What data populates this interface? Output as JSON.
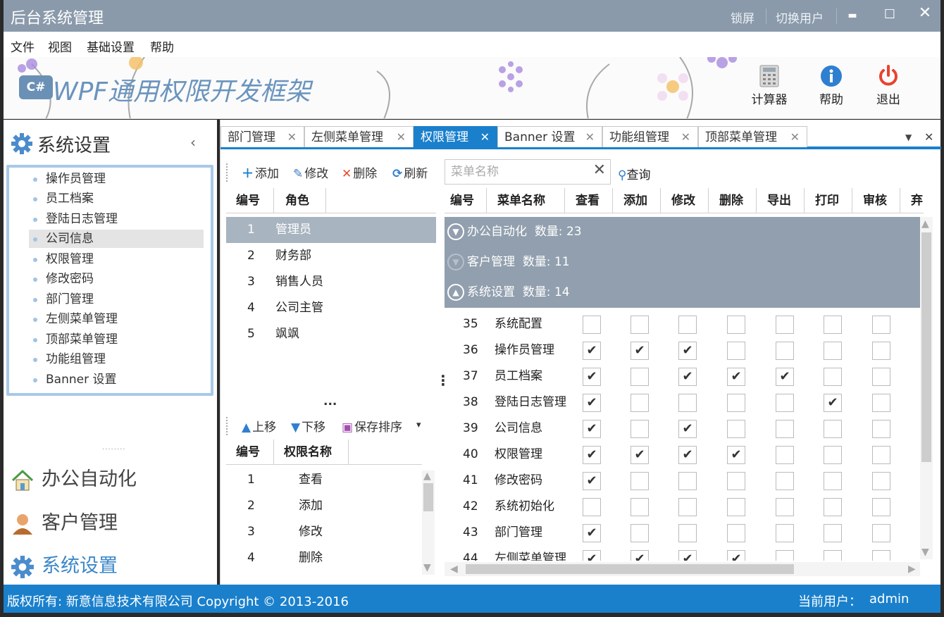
{
  "window": {
    "title": "后台系统管理",
    "lock_label": "锁屏",
    "switch_user_label": "切换用户",
    "minimize": "▬",
    "maximize": "☐",
    "close": "✕"
  },
  "menu": [
    "文件",
    "视图",
    "基础设置",
    "帮助"
  ],
  "banner": {
    "logo_text": "C#",
    "app_title": "WPF通用权限开发框架",
    "tools": [
      {
        "label": "计算器",
        "icon": "calculator-icon"
      },
      {
        "label": "帮助",
        "icon": "info-icon"
      },
      {
        "label": "退出",
        "icon": "power-icon"
      }
    ]
  },
  "sidebar": {
    "header": "系统设置",
    "collapse_glyph": "‹",
    "items": [
      "操作员管理",
      "员工档案",
      "登陆日志管理",
      "公司信息",
      "权限管理",
      "修改密码",
      "部门管理",
      "左侧菜单管理",
      "顶部菜单管理",
      "功能组管理",
      "Banner 设置"
    ],
    "selected_index": 3,
    "splitter": "........",
    "nav": [
      "办公自动化",
      "客户管理",
      "系统设置"
    ],
    "active_nav": 2
  },
  "tabs": {
    "items": [
      "部门管理",
      "左侧菜单管理",
      "权限管理",
      "Banner 设置",
      "功能组管理",
      "顶部菜单管理"
    ],
    "active_index": 2,
    "close_glyph": "✕",
    "dropdown_glyph": "▼"
  },
  "left_toolbar": {
    "add": "添加",
    "edit": "修改",
    "delete": "删除",
    "refresh": "刷新"
  },
  "roles": {
    "headers": [
      "编号",
      "角色"
    ],
    "rows": [
      [
        "1",
        "管理员"
      ],
      [
        "2",
        "财务部"
      ],
      [
        "3",
        "销售人员"
      ],
      [
        "4",
        "公司主管"
      ],
      [
        "5",
        "飒飒"
      ]
    ],
    "selected_index": 0
  },
  "splitter_glyph": "...",
  "vsplitter_glyph": "⋮",
  "sort_toolbar": {
    "up": "上移",
    "down": "下移",
    "save": "保存排序",
    "more": "▾"
  },
  "permissions": {
    "headers": [
      "编号",
      "权限名称"
    ],
    "rows": [
      [
        "1",
        "查看"
      ],
      [
        "2",
        "添加"
      ],
      [
        "3",
        "修改"
      ],
      [
        "4",
        "删除"
      ]
    ]
  },
  "search": {
    "placeholder": "菜单名称",
    "query_label": "查询",
    "clear_glyph": "✕"
  },
  "menu_grid": {
    "headers": [
      "编号",
      "菜单名称",
      "查看",
      "添加",
      "修改",
      "删除",
      "导出",
      "打印",
      "审核",
      "弃"
    ],
    "count_label": "数量:",
    "groups": [
      {
        "name": "办公自动化",
        "count": "23"
      },
      {
        "name": "客户管理",
        "count": "11"
      },
      {
        "name": "系统设置",
        "count": "14"
      }
    ],
    "rows": [
      {
        "id": "35",
        "name": "系统配置",
        "checks": [
          0,
          0,
          0,
          0,
          0,
          0,
          0
        ]
      },
      {
        "id": "36",
        "name": "操作员管理",
        "checks": [
          1,
          1,
          1,
          0,
          0,
          0,
          0
        ]
      },
      {
        "id": "37",
        "name": "员工档案",
        "checks": [
          1,
          0,
          1,
          1,
          1,
          0,
          0
        ]
      },
      {
        "id": "38",
        "name": "登陆日志管理",
        "checks": [
          1,
          0,
          0,
          0,
          0,
          1,
          0
        ]
      },
      {
        "id": "39",
        "name": "公司信息",
        "checks": [
          1,
          0,
          1,
          0,
          0,
          0,
          0
        ]
      },
      {
        "id": "40",
        "name": "权限管理",
        "checks": [
          1,
          1,
          1,
          1,
          0,
          0,
          0
        ]
      },
      {
        "id": "41",
        "name": "修改密码",
        "checks": [
          1,
          0,
          0,
          0,
          0,
          0,
          0
        ]
      },
      {
        "id": "42",
        "name": "系统初始化",
        "checks": [
          0,
          0,
          0,
          0,
          0,
          0,
          0
        ]
      },
      {
        "id": "43",
        "name": "部门管理",
        "checks": [
          1,
          0,
          0,
          0,
          0,
          0,
          0
        ]
      },
      {
        "id": "44",
        "name": "左侧菜单管理",
        "checks": [
          1,
          1,
          1,
          1,
          0,
          0,
          0
        ]
      }
    ]
  },
  "statusbar": {
    "copyright": "版权所有: 新意信息技术有限公司  Copyright © 2013-2016",
    "user_label": "当前用户：",
    "user": "admin"
  }
}
